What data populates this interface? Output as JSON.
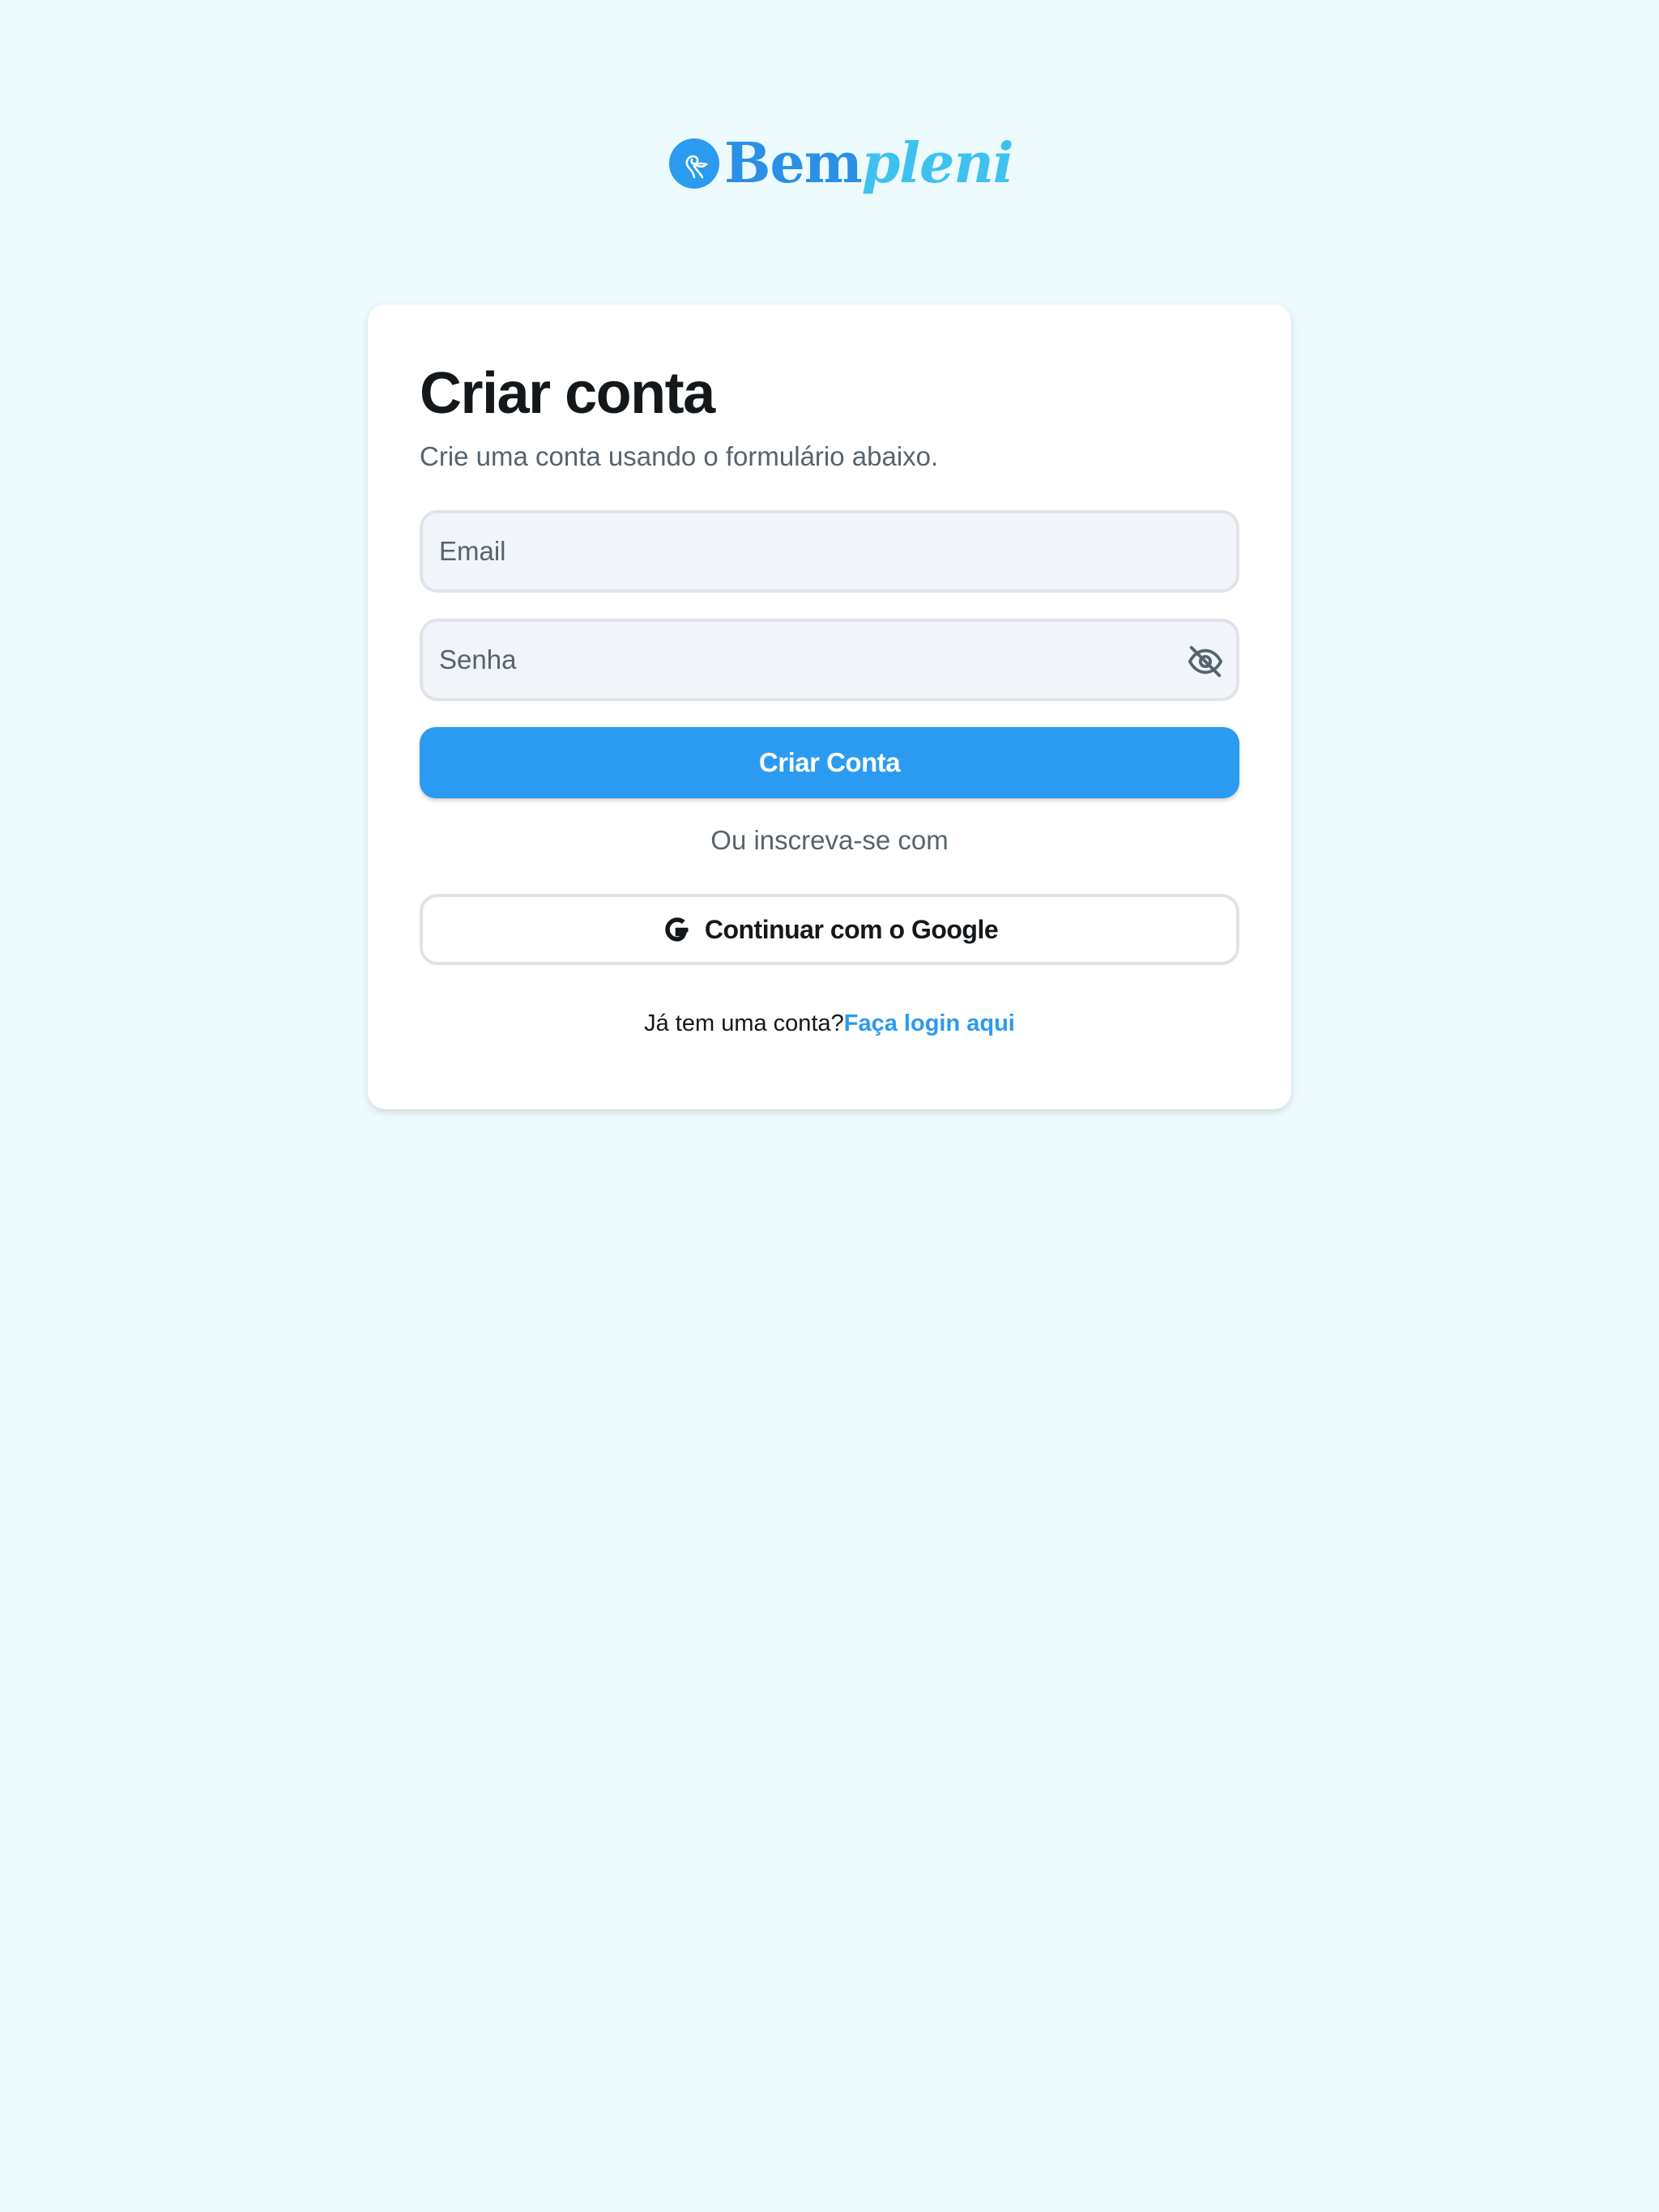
{
  "brand": {
    "name_part1": "Bem",
    "name_part2": "pleni",
    "primary_color": "#2a9bf0",
    "secondary_color": "#3fc1f0",
    "icon": "ribbon-logo-icon"
  },
  "signup": {
    "title": "Criar conta",
    "subtitle": "Crie uma conta usando o formulário abaixo.",
    "email": {
      "value": "",
      "placeholder": "Email"
    },
    "password": {
      "value": "",
      "placeholder": "Senha",
      "visibility_icon": "eye-off-icon"
    },
    "submit_label": "Criar Conta",
    "alt_signup_text": "Ou inscreva-se com",
    "google_label": "Continuar com o Google",
    "google_icon": "google-icon",
    "have_account_text": "Já tem uma conta?",
    "login_link_label": "Faça login aqui"
  },
  "colors": {
    "background": "#edfbff",
    "card": "#ffffff",
    "text_primary": "#14181b",
    "text_secondary": "#57636c",
    "field_background": "#f1f4f8",
    "field_border": "#e0e3e7"
  }
}
